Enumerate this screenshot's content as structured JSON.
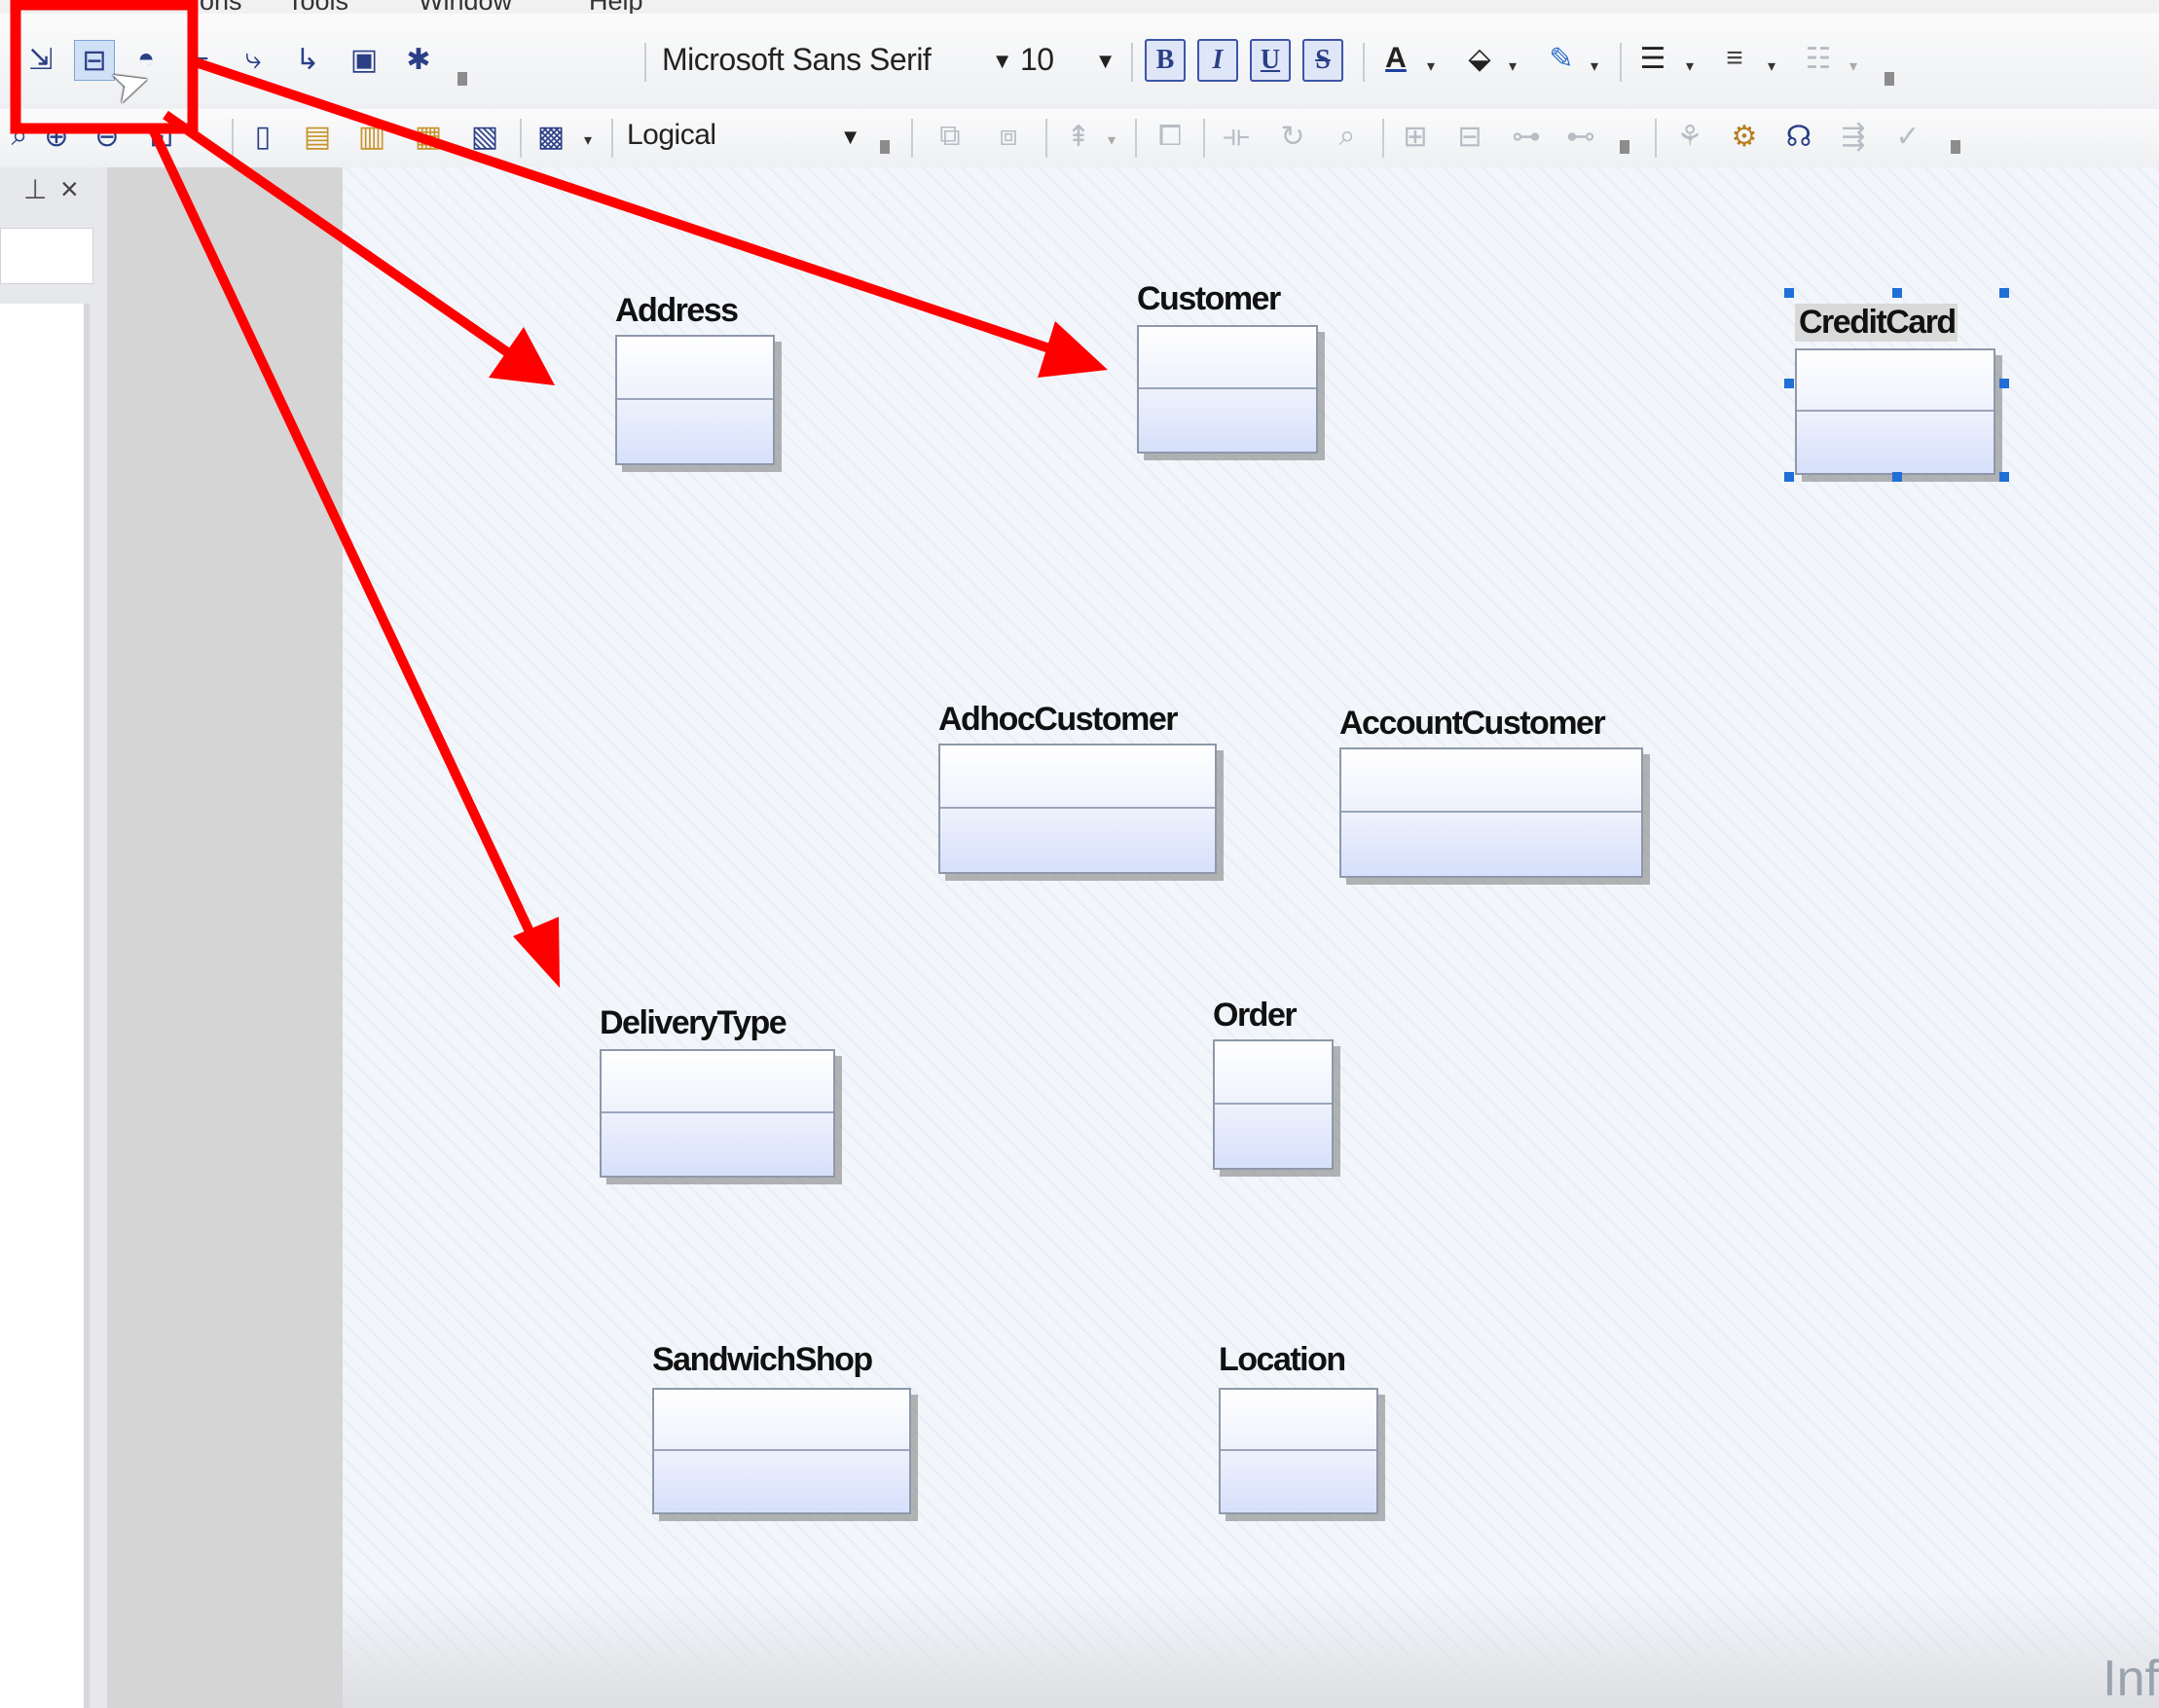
{
  "menu": {
    "items": [
      "Actions",
      "Tools",
      "Window",
      "Help"
    ]
  },
  "toolbar": {
    "font_name": "Microsoft Sans Serif",
    "font_size": "10",
    "bold_label": "B",
    "italic_label": "I",
    "underline_label": "U",
    "strike_label": "S",
    "font_color_label": "A",
    "view_mode": "Logical"
  },
  "dock": {
    "pin_glyph": "⊥",
    "close_glyph": "×"
  },
  "diagram": {
    "classes": {
      "address": "Address",
      "customer": "Customer",
      "creditcard": "CreditCard",
      "adhoccustomer": "AdhocCustomer",
      "accountcustomer": "AccountCustomer",
      "deliverytype": "DeliveryType",
      "order": "Order",
      "sandwichshop": "SandwichShop",
      "location": "Location"
    },
    "selected": "CreditCard"
  },
  "annotation": {
    "color": "#ff0000"
  },
  "watermark": "Inf"
}
